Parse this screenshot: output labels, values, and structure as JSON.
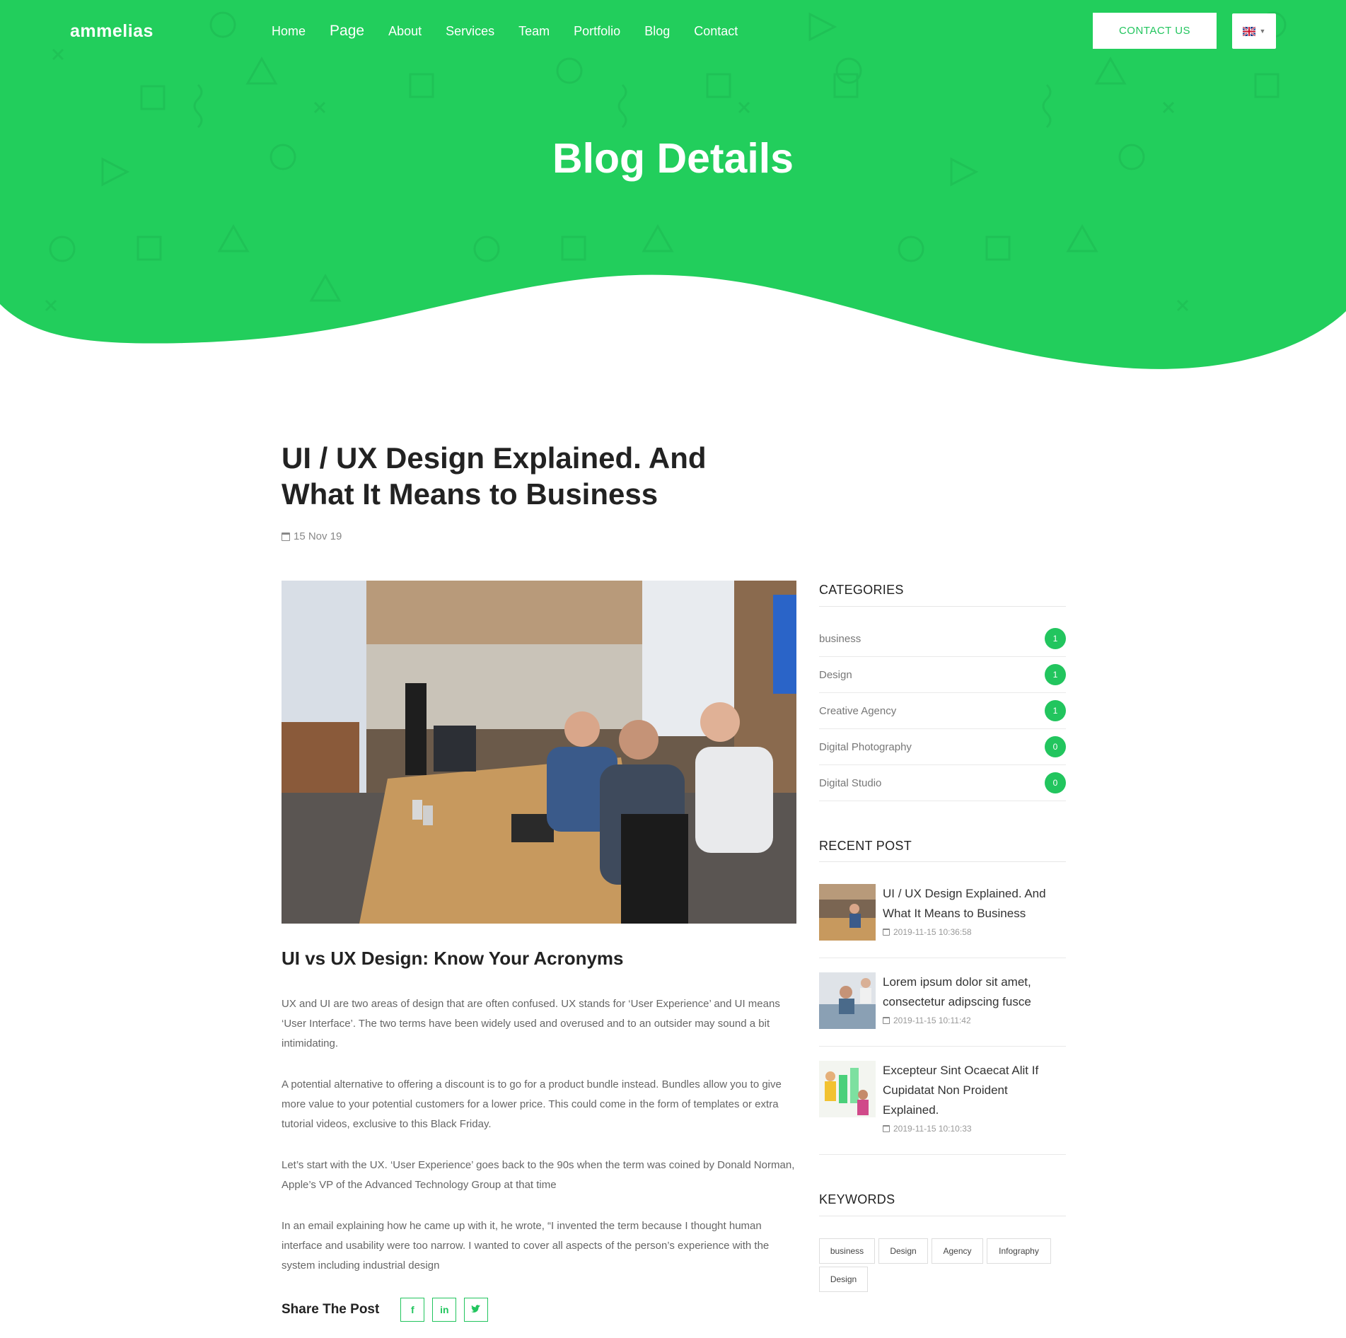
{
  "brand": {
    "logo": "ammelias",
    "accent": "#22c55e"
  },
  "nav": {
    "items": [
      "Home",
      "Page",
      "About",
      "Services",
      "Team",
      "Portfolio",
      "Blog",
      "Contact"
    ]
  },
  "header": {
    "contact_label": "CONTACT US",
    "language_icon": "uk-flag-icon"
  },
  "hero": {
    "title": "Blog Details"
  },
  "article": {
    "title": "UI / UX Design Explained. And What It Means to Business",
    "date": "15 Nov 19",
    "subtitle": "UI vs UX Design: Know Your Acronyms",
    "paragraphs": [
      "UX and UI are two areas of design that are often confused. UX stands for ‘User Experience’ and UI means ‘User Interface’. The two terms have been widely used and overused and to an outsider may sound a bit intimidating.",
      "A potential alternative to offering a discount is to go for a product bundle instead. Bundles allow you to give more value to your potential customers for a lower price. This could come in the form of templates or extra tutorial videos, exclusive to this Black Friday.",
      "Let’s start with the UX. ‘User Experience’ goes back to the 90s when the term was coined by Donald Norman, Apple’s VP of the Advanced Technology Group at that time",
      "In an email explaining how he came up with it, he wrote, “I invented the term because I thought human interface and usability were too narrow. I wanted to cover all aspects of the person’s experience with the system including industrial design"
    ],
    "share_label": "Share The Post",
    "share_buttons": [
      "f",
      "in",
      "t"
    ]
  },
  "sidebar": {
    "categories_heading": "CATEGORIES",
    "categories": [
      {
        "label": "business",
        "count": "1"
      },
      {
        "label": "Design",
        "count": "1"
      },
      {
        "label": "Creative Agency",
        "count": "1"
      },
      {
        "label": "Digital Photography",
        "count": "0"
      },
      {
        "label": "Digital Studio",
        "count": "0"
      }
    ],
    "recent_heading": "RECENT POST",
    "recent": [
      {
        "title": "UI / UX Design Explained. And What It Means to Business",
        "date": "2019-11-15 10:36:58"
      },
      {
        "title": "Lorem ipsum dolor sit amet, consectetur adipscing fusce",
        "date": "2019-11-15 10:11:42"
      },
      {
        "title": "Excepteur Sint Ocaecat Alit If Cupidatat Non Proident Explained.",
        "date": "2019-11-15 10:10:33"
      }
    ],
    "keywords_heading": "KEYWORDS",
    "keywords": [
      "business",
      "Design",
      "Agency",
      "Infography",
      "Design"
    ]
  }
}
